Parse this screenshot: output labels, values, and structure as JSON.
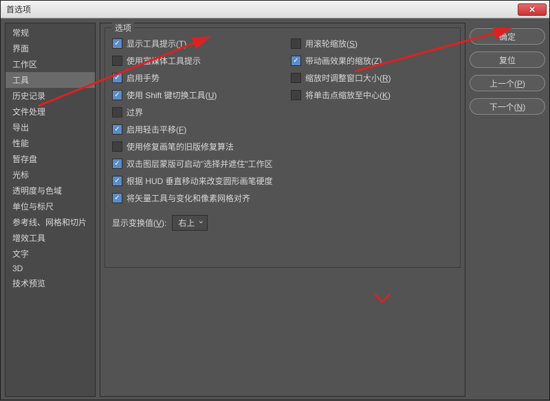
{
  "titlebar": {
    "title": "首选项"
  },
  "sidebar": {
    "items": [
      "常规",
      "界面",
      "工作区",
      "工具",
      "历史记录",
      "文件处理",
      "导出",
      "性能",
      "暂存盘",
      "光标",
      "透明度与色域",
      "单位与标尺",
      "参考线、网格和切片",
      "增效工具",
      "文字",
      "3D",
      "技术预览"
    ],
    "selected_index": 3
  },
  "group": {
    "title": "选项"
  },
  "options_left": [
    {
      "label": "显示工具提示",
      "hotkey": "T",
      "checked": true
    },
    {
      "label": "使用富媒体工具提示",
      "hotkey": "",
      "checked": false
    },
    {
      "label": "启用手势",
      "hotkey": "",
      "checked": true
    },
    {
      "label": "使用 Shift 键切换工具",
      "hotkey": "U",
      "checked": true
    },
    {
      "label": "过界",
      "hotkey": "",
      "checked": false
    },
    {
      "label": "启用轻击平移",
      "hotkey": "F",
      "checked": true
    },
    {
      "label": "使用修复画笔的旧版修复算法",
      "hotkey": "",
      "checked": false
    },
    {
      "label": "双击图层蒙版可启动\"选择并遮住\"工作区",
      "hotkey": "",
      "checked": true
    },
    {
      "label": "根据 HUD 垂直移动来改变圆形画笔硬度",
      "hotkey": "",
      "checked": true
    },
    {
      "label": "将矢量工具与变化和像素网格对齐",
      "hotkey": "",
      "checked": true
    }
  ],
  "options_right": [
    {
      "label": "用滚轮缩放",
      "hotkey": "S",
      "checked": false
    },
    {
      "label": "带动画效果的缩放",
      "hotkey": "Z",
      "checked": true
    },
    {
      "label": "缩放时调整窗口大小",
      "hotkey": "R",
      "checked": false
    },
    {
      "label": "将单击点缩放至中心",
      "hotkey": "K",
      "checked": false
    }
  ],
  "transform_display": {
    "label": "显示变换值",
    "hotkey": "V",
    "value": "右上"
  },
  "buttons": {
    "ok": "确定",
    "reset": "复位",
    "prev": "上一个",
    "prev_hot": "P",
    "next": "下一个",
    "next_hot": "N"
  }
}
